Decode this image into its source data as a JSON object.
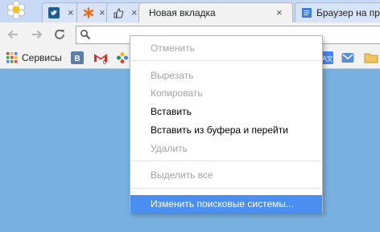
{
  "tabs": [
    {
      "label": "",
      "favicon": "twitter-icon"
    },
    {
      "label": "",
      "favicon": "asterisk-icon"
    },
    {
      "label": "",
      "favicon": "thumbs-up-icon"
    },
    {
      "label": "Новая вкладка",
      "favicon": "none",
      "active": true
    },
    {
      "label": "Браузер на прос",
      "favicon": "document-icon"
    }
  ],
  "bookmarks": {
    "apps_label": "Сервисы",
    "items": [
      "vk-icon",
      "gmail-icon",
      "flower-icon",
      "translate-icon",
      "mail-icon",
      "folder-icon"
    ]
  },
  "omnibox": {
    "value": "",
    "icon": "search-icon"
  },
  "context_menu": {
    "items": [
      {
        "label": "Отменить",
        "state": "disabled"
      },
      {
        "label": "Вырезать",
        "state": "disabled"
      },
      {
        "label": "Копировать",
        "state": "disabled"
      },
      {
        "label": "Вставить",
        "state": "enabled"
      },
      {
        "label": "Вставить из буфера и перейти",
        "state": "enabled"
      },
      {
        "label": "Удалить",
        "state": "disabled"
      },
      {
        "label": "Выделить все",
        "state": "disabled"
      },
      {
        "label": "Изменить поисковые системы...",
        "state": "highlighted"
      }
    ]
  },
  "colors": {
    "page_background": "#78b1e0",
    "menu_highlight": "#4a8ef2",
    "disabled_text": "#a3a3a3"
  }
}
